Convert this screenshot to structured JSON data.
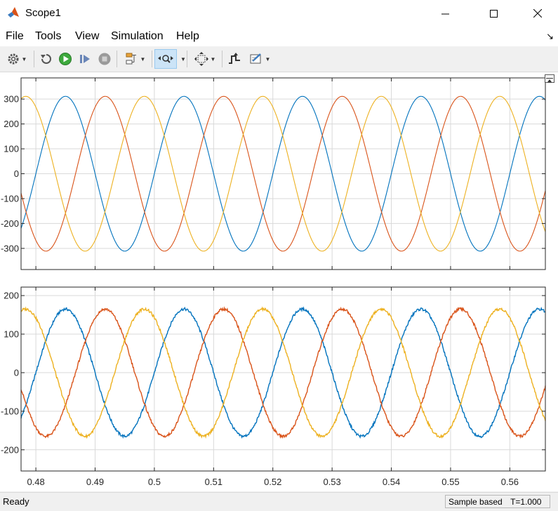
{
  "window": {
    "title": "Scope1"
  },
  "menu": {
    "items": [
      "File",
      "Tools",
      "View",
      "Simulation",
      "Help"
    ]
  },
  "toolbar": {
    "icons": [
      "gear-icon",
      "step-back-icon",
      "run-icon",
      "step-forward-icon",
      "stop-icon",
      "signal-select-icon",
      "zoom-icon",
      "fit-axes-icon",
      "triggers-icon",
      "measurements-icon"
    ],
    "active": "zoom-icon"
  },
  "colors": {
    "phase_a": "#0072bd",
    "phase_b": "#d95319",
    "phase_c": "#edb120",
    "grid": "#d9d9d9",
    "axis": "#262626"
  },
  "status": {
    "left": "Ready",
    "sample": "Sample based",
    "time": "T=1.000"
  },
  "chart_data": [
    {
      "type": "line",
      "title": "",
      "xlim": [
        0.4775,
        0.566
      ],
      "ylim": [
        -385,
        385
      ],
      "yticks": [
        -300,
        -200,
        -100,
        0,
        100,
        200,
        300
      ],
      "grid": true,
      "legend": "none",
      "series": [
        {
          "amplitude": 311,
          "frequency_hz": 50,
          "peak_times": [
            0.485,
            0.505,
            0.525,
            0.545,
            0.565
          ]
        },
        {
          "amplitude": 311,
          "frequency_hz": 50,
          "peak_times": [
            0.4917,
            0.5117,
            0.5317,
            0.5517
          ]
        },
        {
          "amplitude": 311,
          "frequency_hz": 50,
          "peak_times": [
            0.4783,
            0.4983,
            0.5183,
            0.5383,
            0.5583
          ]
        }
      ]
    },
    {
      "type": "line",
      "title": "",
      "xlim": [
        0.4775,
        0.566
      ],
      "ylim": [
        -255,
        222
      ],
      "yticks": [
        -200,
        -100,
        0,
        100,
        200
      ],
      "xticks": [
        0.48,
        0.49,
        0.5,
        0.51,
        0.52,
        0.53,
        0.54,
        0.55,
        0.56
      ],
      "grid": true,
      "legend": "none",
      "series": [
        {
          "amplitude": 165,
          "frequency_hz": 50,
          "peak_times": [
            0.485,
            0.505,
            0.525,
            0.545,
            0.565
          ]
        },
        {
          "amplitude": 165,
          "frequency_hz": 50,
          "peak_times": [
            0.4917,
            0.5117,
            0.5317,
            0.5517
          ]
        },
        {
          "amplitude": 165,
          "frequency_hz": 50,
          "peak_times": [
            0.4783,
            0.4983,
            0.5183,
            0.5383,
            0.5583
          ]
        }
      ]
    }
  ]
}
